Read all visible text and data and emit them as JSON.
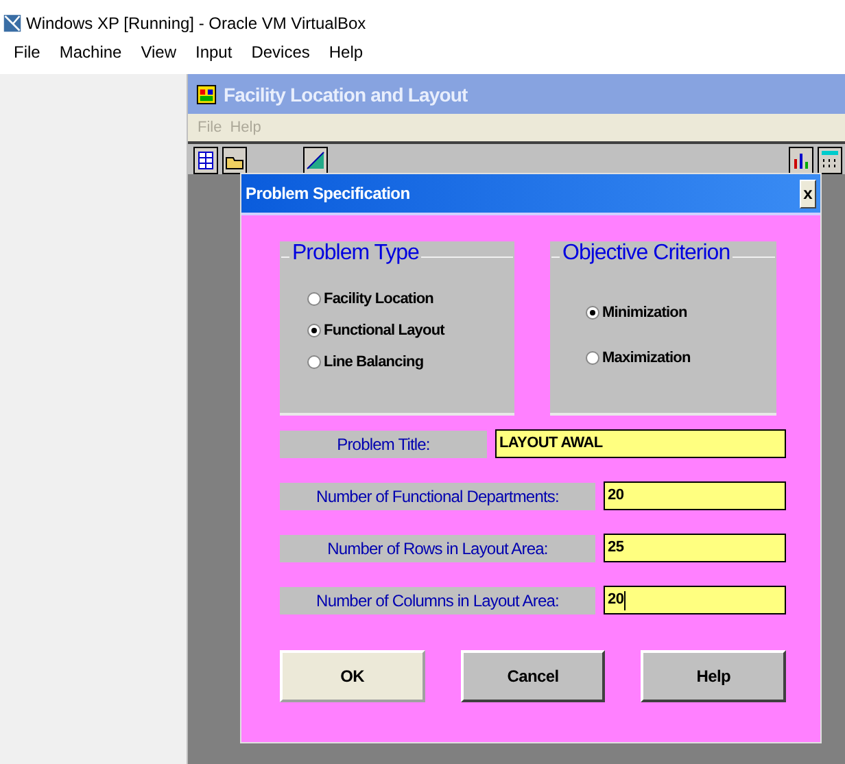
{
  "host": {
    "title": "Windows XP [Running] - Oracle VM VirtualBox",
    "menu": [
      "File",
      "Machine",
      "View",
      "Input",
      "Devices",
      "Help"
    ]
  },
  "app": {
    "title": "Facility Location and Layout",
    "menu_disabled": true,
    "menu": [
      "File",
      "Help"
    ]
  },
  "dialog": {
    "title": "Problem Specification",
    "close": "x",
    "groups": [
      {
        "title": "Problem Type",
        "options": [
          {
            "label": "Facility Location",
            "selected": false
          },
          {
            "label": "Functional Layout",
            "selected": true
          },
          {
            "label": "Line Balancing",
            "selected": false
          }
        ]
      },
      {
        "title": "Objective Criterion",
        "options": [
          {
            "label": "Minimization",
            "selected": true
          },
          {
            "label": "Maximization",
            "selected": false
          }
        ]
      }
    ],
    "fields": [
      {
        "kind": "wide",
        "label": "Problem Title:",
        "value": "LAYOUT AWAL",
        "focused": false
      },
      {
        "kind": "narrow",
        "label": "Number of Functional Departments:",
        "value": "20",
        "focused": false
      },
      {
        "kind": "narrow",
        "label": "Number of Rows in Layout Area:",
        "value": "25",
        "focused": false
      },
      {
        "kind": "narrow",
        "label": "Number of Columns in Layout Area:",
        "value": "20",
        "focused": true
      }
    ],
    "buttons": [
      {
        "label": "OK",
        "focused": true
      },
      {
        "label": "Cancel",
        "focused": false
      },
      {
        "label": "Help",
        "focused": false
      }
    ]
  }
}
